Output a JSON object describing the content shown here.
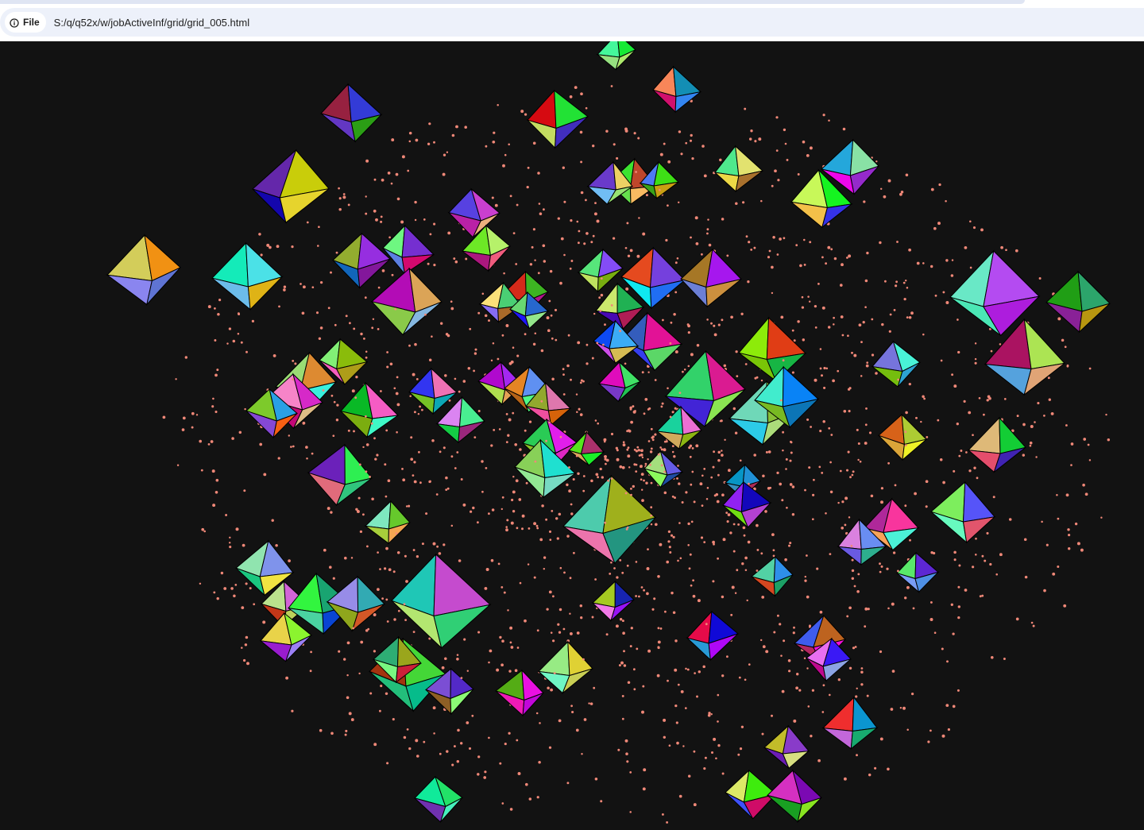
{
  "browser": {
    "site_info_label": "File",
    "site_info_icon": "info-circle-icon",
    "url": "S:/q/q52x/w/jobActiveInf/grid/grid_005.html"
  },
  "scene": {
    "description_type": "3d-webgl-canvas",
    "background_color": "#121212",
    "dot_color": "#f08878",
    "object_shape": "octahedron",
    "edge_color": "#000000"
  }
}
